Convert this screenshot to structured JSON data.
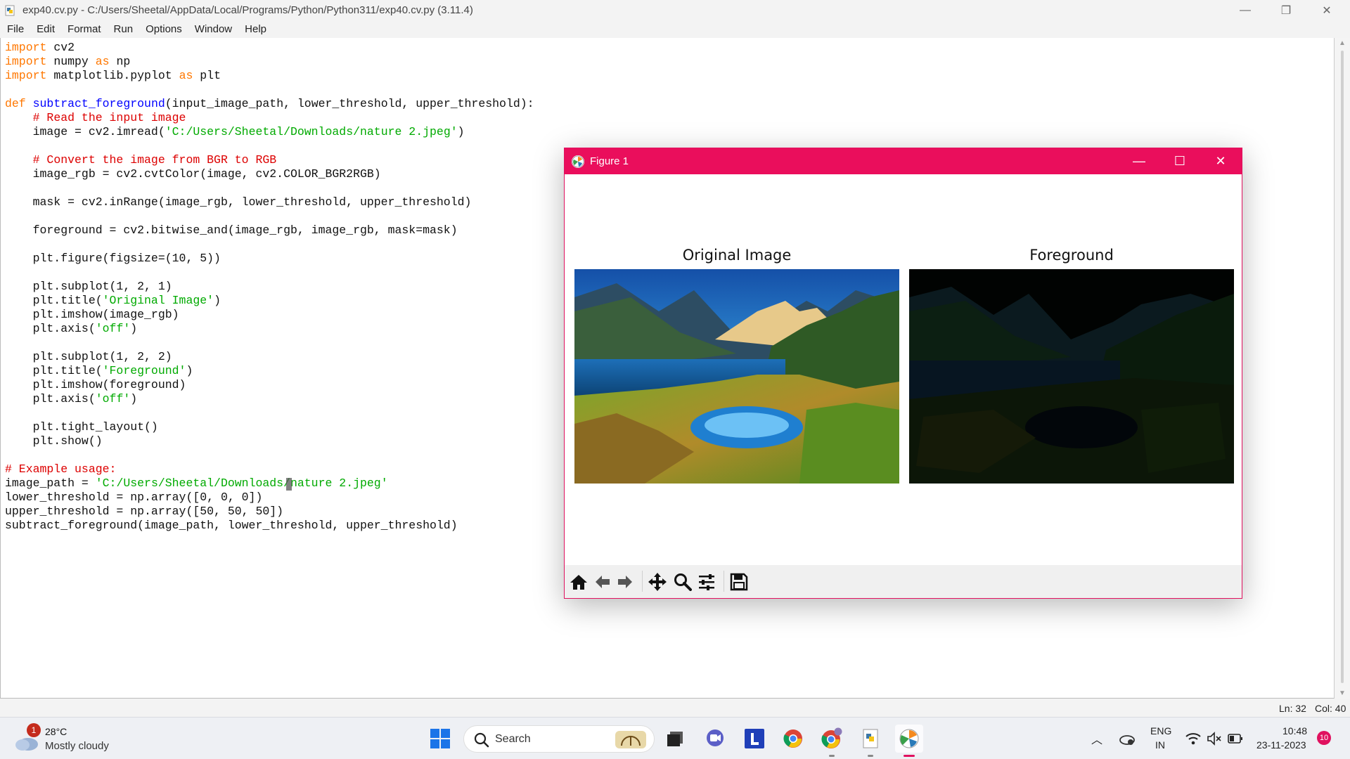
{
  "window": {
    "title": "exp40.cv.py - C:/Users/Sheetal/AppData/Local/Programs/Python/Python311/exp40.cv.py (3.11.4)",
    "controls": {
      "minimize": "—",
      "restore": "❐",
      "close": "✕"
    }
  },
  "menu": [
    "File",
    "Edit",
    "Format",
    "Run",
    "Options",
    "Window",
    "Help"
  ],
  "code_lines": [
    [
      {
        "t": "import",
        "c": "kw"
      },
      {
        "t": " cv2"
      }
    ],
    [
      {
        "t": "import",
        "c": "kw"
      },
      {
        "t": " numpy "
      },
      {
        "t": "as",
        "c": "kw"
      },
      {
        "t": " np"
      }
    ],
    [
      {
        "t": "import",
        "c": "kw"
      },
      {
        "t": " matplotlib.pyplot "
      },
      {
        "t": "as",
        "c": "kw"
      },
      {
        "t": " plt"
      }
    ],
    [],
    [
      {
        "t": "def",
        "c": "kw"
      },
      {
        "t": " "
      },
      {
        "t": "subtract_foreground",
        "c": "def"
      },
      {
        "t": "(input_image_path, lower_threshold, upper_threshold):"
      }
    ],
    [
      {
        "t": "    "
      },
      {
        "t": "# Read the input image",
        "c": "cm"
      }
    ],
    [
      {
        "t": "    image = cv2.imread("
      },
      {
        "t": "'C:/Users/Sheetal/Downloads/nature 2.jpeg'",
        "c": "str"
      },
      {
        "t": ")"
      }
    ],
    [],
    [
      {
        "t": "    "
      },
      {
        "t": "# Convert the image from BGR to RGB",
        "c": "cm"
      }
    ],
    [
      {
        "t": "    image_rgb = cv2.cvtColor(image, cv2.COLOR_BGR2RGB)"
      }
    ],
    [],
    [
      {
        "t": "    mask = cv2.inRange(image_rgb, lower_threshold, upper_threshold)"
      }
    ],
    [],
    [
      {
        "t": "    foreground = cv2.bitwise_and(image_rgb, image_rgb, mask=mask)"
      }
    ],
    [],
    [
      {
        "t": "    plt.figure(figsize=(10, 5))"
      }
    ],
    [],
    [
      {
        "t": "    plt.subplot(1, 2, 1)"
      }
    ],
    [
      {
        "t": "    plt.title("
      },
      {
        "t": "'Original Image'",
        "c": "str"
      },
      {
        "t": ")"
      }
    ],
    [
      {
        "t": "    plt.imshow(image_rgb)"
      }
    ],
    [
      {
        "t": "    plt.axis("
      },
      {
        "t": "'off'",
        "c": "str"
      },
      {
        "t": ")"
      }
    ],
    [],
    [
      {
        "t": "    plt.subplot(1, 2, 2)"
      }
    ],
    [
      {
        "t": "    plt.title("
      },
      {
        "t": "'Foreground'",
        "c": "str"
      },
      {
        "t": ")"
      }
    ],
    [
      {
        "t": "    plt.imshow(foreground)"
      }
    ],
    [
      {
        "t": "    plt.axis("
      },
      {
        "t": "'off'",
        "c": "str"
      },
      {
        "t": ")"
      }
    ],
    [],
    [
      {
        "t": "    plt.tight_layout()"
      }
    ],
    [
      {
        "t": "    plt.show()"
      }
    ],
    [],
    [
      {
        "t": "# Example usage:",
        "c": "cm"
      }
    ],
    [
      {
        "t": "image_path = "
      },
      {
        "t": "'C:/Users/Sheetal/Downloads/nature 2.jpeg'",
        "c": "str"
      }
    ],
    [
      {
        "t": "lower_threshold = np.array([0, 0, 0])"
      }
    ],
    [
      {
        "t": "upper_threshold = np.array([50, 50, 50])"
      }
    ],
    [
      {
        "t": "subtract_foreground(image_path, lower_threshold, upper_threshold)"
      }
    ]
  ],
  "status": {
    "line": "Ln: 32",
    "col": "Col: 40"
  },
  "figure": {
    "title": "Figure 1",
    "controls": {
      "minimize": "—",
      "maximize": "☐",
      "close": "✕"
    },
    "subplots": [
      "Original Image",
      "Foreground"
    ],
    "toolbar": [
      "home-icon",
      "back-arrow-icon",
      "forward-arrow-icon",
      "pan-icon",
      "zoom-icon",
      "configure-subplots-icon",
      "save-icon"
    ]
  },
  "taskbar": {
    "weather": {
      "badge": "1",
      "temp": "28°C",
      "condition": "Mostly cloudy"
    },
    "search_label": "Search",
    "apps": [
      "windows-start-icon",
      "search-icon",
      "task-view-icon",
      "meet-icon",
      "l-app-icon",
      "chrome-icon",
      "chrome-profile-icon",
      "python-file-icon",
      "idle-figure-icon"
    ],
    "language": {
      "line1": "ENG",
      "line2": "IN"
    },
    "clock": {
      "time": "10:48",
      "date": "23-11-2023"
    },
    "notification_count": "10"
  },
  "colors": {
    "figure_accent": "#ea0e5c",
    "keyword": "#ff7700",
    "comment": "#dd0000",
    "string": "#00aa00",
    "def_name": "#0000ff"
  }
}
